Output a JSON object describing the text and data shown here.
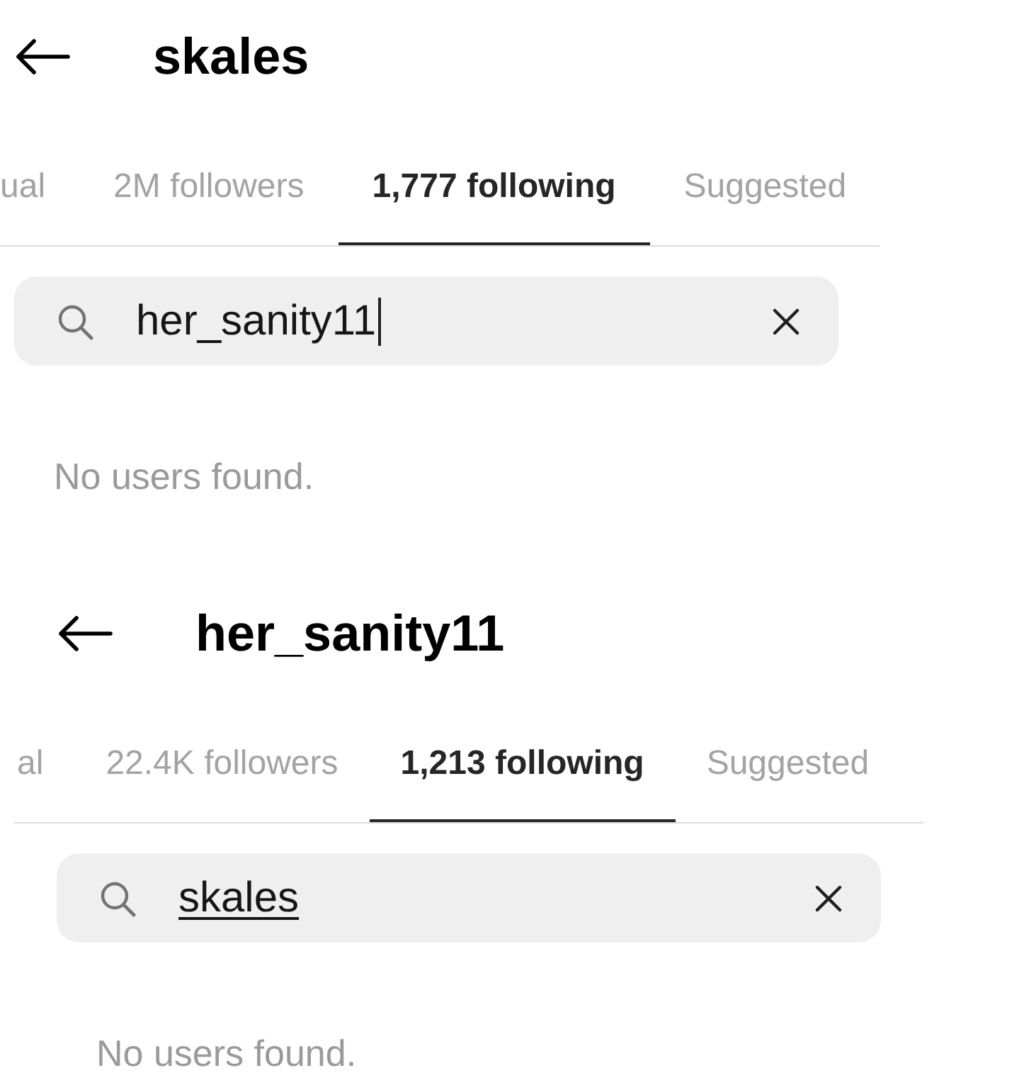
{
  "panels": [
    {
      "title": "skales",
      "tabs": [
        {
          "label": "ual",
          "selected": false
        },
        {
          "label": "2M followers",
          "selected": false
        },
        {
          "label": "1,777 following",
          "selected": true
        },
        {
          "label": "Suggested",
          "selected": false
        }
      ],
      "search": {
        "value": "her_sanity11",
        "caret": true,
        "underlined": false
      },
      "message": "No users found."
    },
    {
      "title": "her_sanity11",
      "tabs": [
        {
          "label": "al",
          "selected": false
        },
        {
          "label": "22.4K followers",
          "selected": false
        },
        {
          "label": "1,213 following",
          "selected": true
        },
        {
          "label": "Suggested",
          "selected": false
        }
      ],
      "search": {
        "value": "skales",
        "caret": false,
        "underlined": true
      },
      "message": "No users found."
    }
  ]
}
